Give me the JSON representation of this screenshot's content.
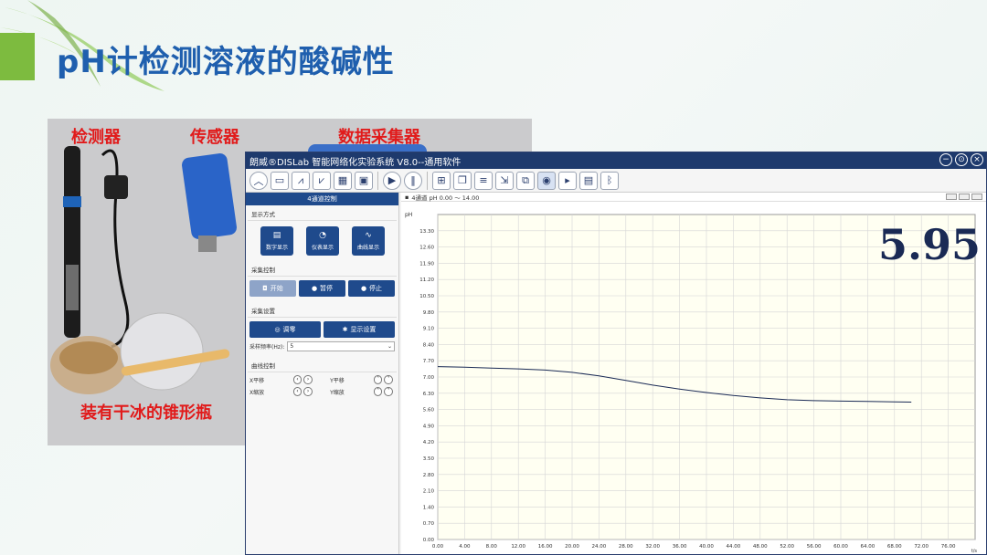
{
  "slide": {
    "title": "pH计检测溶液的酸碱性",
    "labels": {
      "detector": "检测器",
      "sensor": "传感器",
      "collector": "数据采集器",
      "flask": "装有干冰的锥形瓶"
    }
  },
  "window": {
    "title": "朗威®DISLab 智能网络化实验系统 V8.0--通用软件",
    "controls": [
      "−",
      "⊙",
      "×"
    ]
  },
  "panel": {
    "header": "4通道控制",
    "display_mode_title": "显示方式",
    "display_buttons": [
      {
        "icon": "▤",
        "label": "数字显示"
      },
      {
        "icon": "◔",
        "label": "仪表显示"
      },
      {
        "icon": "∿",
        "label": "曲线显示"
      }
    ],
    "collect_title": "采集控制",
    "collect_buttons": [
      "开始",
      "暂停",
      "停止"
    ],
    "settings_title": "采集设置",
    "settings_buttons": [
      "调零",
      "显示设置"
    ],
    "freq_label": "采样频率(Hz):",
    "freq_value": "5",
    "curve_title": "曲线控制",
    "pan_x": "X平移",
    "pan_y": "Y平移",
    "zoom_x": "X缩放",
    "zoom_y": "Y缩放"
  },
  "chart_header": "4通道 pH 0.00 ～ 14.00",
  "ph_reading": "5.95",
  "chart_data": {
    "type": "line",
    "ylabel": "pH",
    "xlabel": "t/s",
    "ylim": [
      0,
      14
    ],
    "xlim": [
      0,
      80
    ],
    "yticks": [
      "0.00",
      "0.70",
      "1.40",
      "2.10",
      "2.80",
      "3.50",
      "4.20",
      "4.90",
      "5.60",
      "6.30",
      "7.00",
      "7.70",
      "8.40",
      "9.10",
      "9.80",
      "10.50",
      "11.20",
      "11.90",
      "12.60",
      "13.30"
    ],
    "xticks": [
      "0.00",
      "4.00",
      "8.00",
      "12.00",
      "16.00",
      "20.00",
      "24.00",
      "28.00",
      "32.00",
      "36.00",
      "40.00",
      "44.00",
      "48.00",
      "52.00",
      "56.00",
      "60.00",
      "64.00",
      "68.00",
      "72.00",
      "76.00"
    ],
    "series": [
      {
        "x": [
          0,
          4,
          8,
          12,
          16,
          20,
          24,
          28,
          32,
          36,
          40,
          44,
          48,
          52,
          56,
          60,
          64,
          68,
          70.5
        ],
        "y": [
          7.45,
          7.42,
          7.38,
          7.35,
          7.3,
          7.2,
          7.05,
          6.85,
          6.65,
          6.48,
          6.33,
          6.2,
          6.1,
          6.02,
          5.98,
          5.96,
          5.95,
          5.93,
          5.92
        ]
      }
    ]
  }
}
